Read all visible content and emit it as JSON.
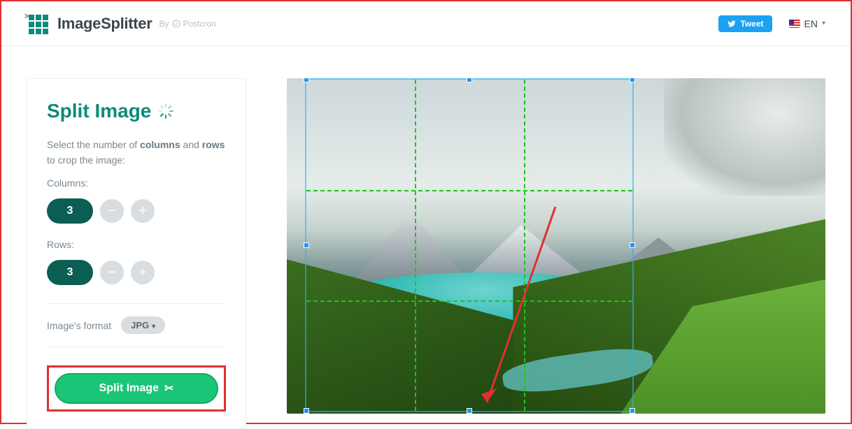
{
  "header": {
    "brand": "ImageSplitter",
    "by_label": "By",
    "postcron": "Postcron",
    "tweet_label": "Tweet",
    "lang_label": "EN"
  },
  "panel": {
    "title": "Split Image",
    "desc_pre": "Select the number of ",
    "desc_cols": "columns",
    "desc_mid": " and ",
    "desc_rows": "rows",
    "desc_post": " to crop the image:",
    "columns_label": "Columns:",
    "rows_label": "Rows:",
    "columns_value": "3",
    "rows_value": "3",
    "minus": "−",
    "plus": "+",
    "format_label": "Image's format",
    "format_value": "JPG",
    "split_button": "Split Image"
  },
  "preview": {
    "grid_cols": 3,
    "grid_rows": 3
  }
}
